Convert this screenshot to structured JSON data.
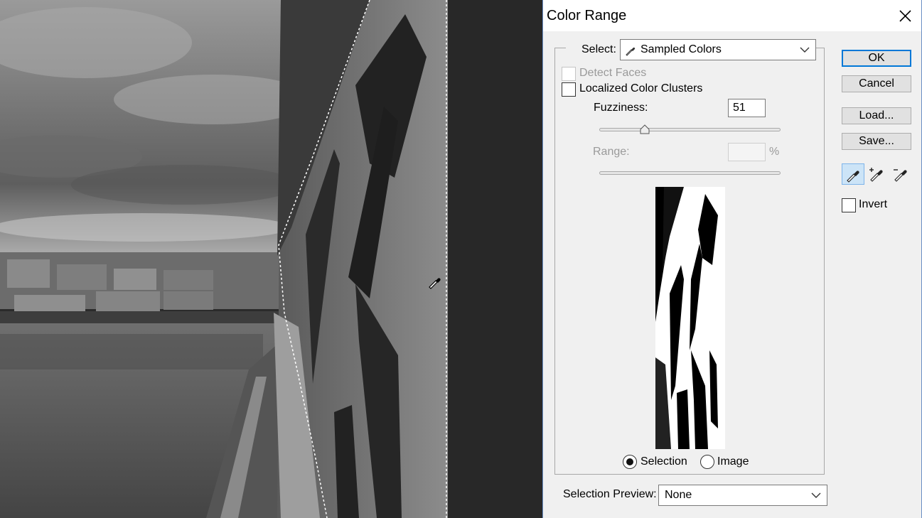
{
  "dialog": {
    "title": "Color Range",
    "select_label": "Select:",
    "select_value": "Sampled Colors",
    "detect_faces_label": "Detect Faces",
    "localized_label": "Localized Color Clusters",
    "fuzziness_label": "Fuzziness:",
    "fuzziness_value": "51",
    "fuzziness_level": 0.25,
    "range_label": "Range:",
    "range_value": "",
    "range_unit": "%",
    "selection_label": "Selection",
    "image_label": "Image",
    "preview_mode": "Selection",
    "selection_preview_label": "Selection Preview:",
    "selection_preview_value": "None",
    "buttons": {
      "ok": "OK",
      "cancel": "Cancel",
      "load": "Load...",
      "save": "Save..."
    },
    "tools": [
      "eyedropper-icon",
      "eyedropper-plus-icon",
      "eyedropper-minus-icon"
    ],
    "active_tool": "eyedropper-icon",
    "invert_label": "Invert",
    "invert_checked": false,
    "localized_checked": false,
    "detect_faces_checked": false,
    "accent_color": "#0078d7"
  }
}
